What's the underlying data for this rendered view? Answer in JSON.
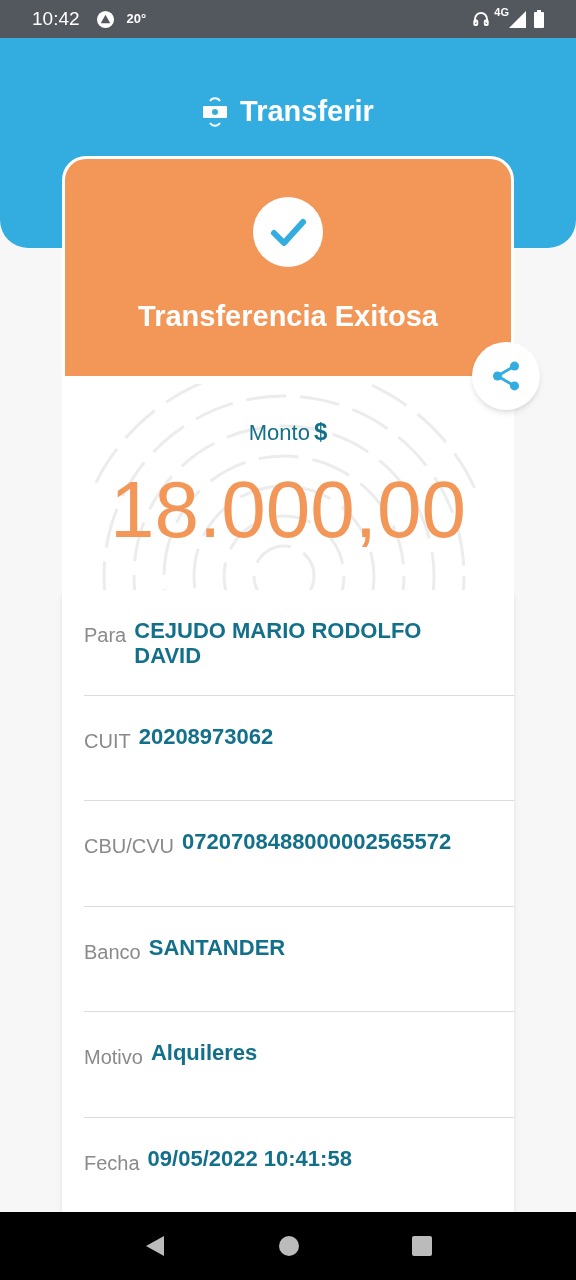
{
  "status_bar": {
    "time": "10:42",
    "temperature": "20°",
    "network": "4G"
  },
  "header": {
    "title": "Transferir"
  },
  "result": {
    "title": "Transferencia Exitosa"
  },
  "amount": {
    "label": "Monto",
    "currency": "$",
    "value": "18.000,00"
  },
  "details": [
    {
      "label": "Para",
      "value": "CEJUDO MARIO RODOLFO DAVID"
    },
    {
      "label": "CUIT",
      "value": "20208973062"
    },
    {
      "label": "CBU/CVU",
      "value": "0720708488000002565572"
    },
    {
      "label": "Banco",
      "value": "SANTANDER"
    },
    {
      "label": "Motivo",
      "value": "Alquileres"
    },
    {
      "label": "Fecha",
      "value": "09/05/2022 10:41:58"
    }
  ]
}
